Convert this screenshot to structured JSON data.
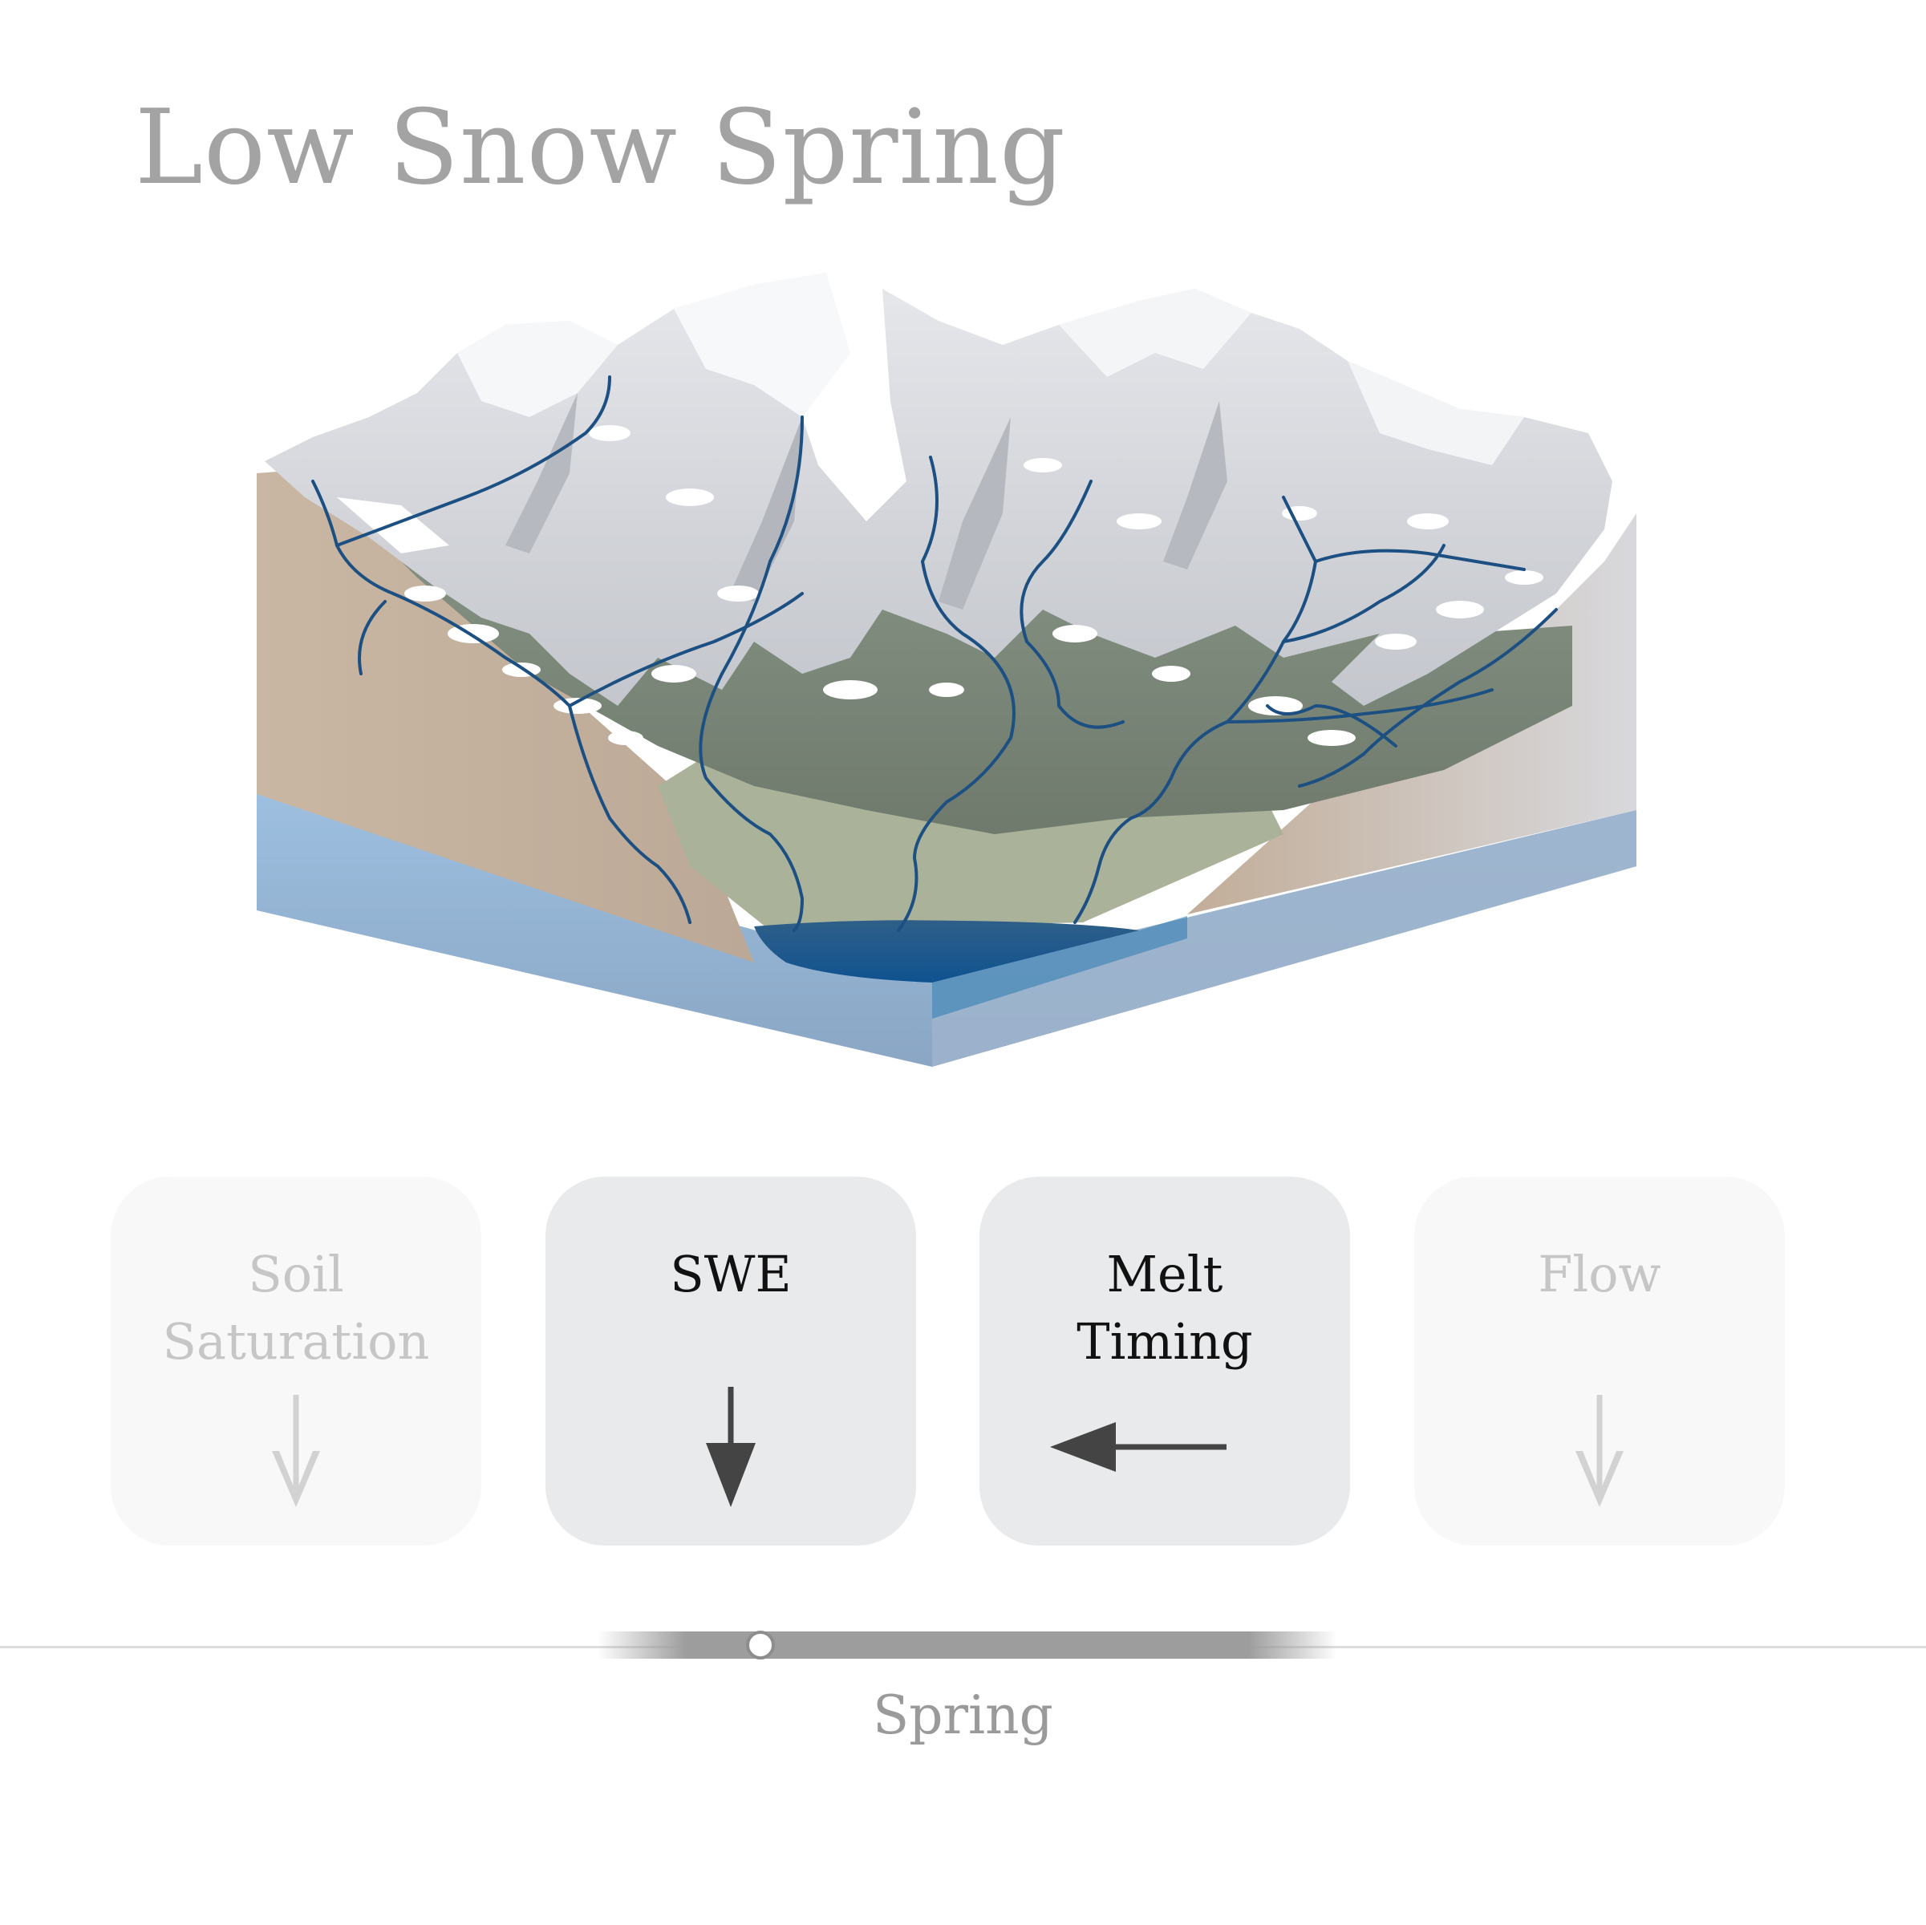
{
  "title": "Low Snow Spring",
  "cards": [
    {
      "label_lines": [
        "Soil",
        "Saturation"
      ],
      "arrow_direction": "down",
      "state": "dimmed"
    },
    {
      "label_lines": [
        "SWE"
      ],
      "arrow_direction": "down",
      "state": "active"
    },
    {
      "label_lines": [
        "Melt",
        "Timing"
      ],
      "arrow_direction": "left",
      "state": "active"
    },
    {
      "label_lines": [
        "Flow"
      ],
      "arrow_direction": "down",
      "state": "dimmed"
    }
  ],
  "timeline": {
    "current_season": "Spring",
    "position_fraction": 0.22
  },
  "colors": {
    "title": "#a3a3a3",
    "card_active_bg": "#e9eaeb",
    "card_dim_bg": "#f8f8f8",
    "arrow_active": "#444444",
    "arrow_dim": "#d2d2d2",
    "stream": "#1c4f82",
    "lake": "#1f5f94",
    "groundwater": "#8fb2d4"
  }
}
